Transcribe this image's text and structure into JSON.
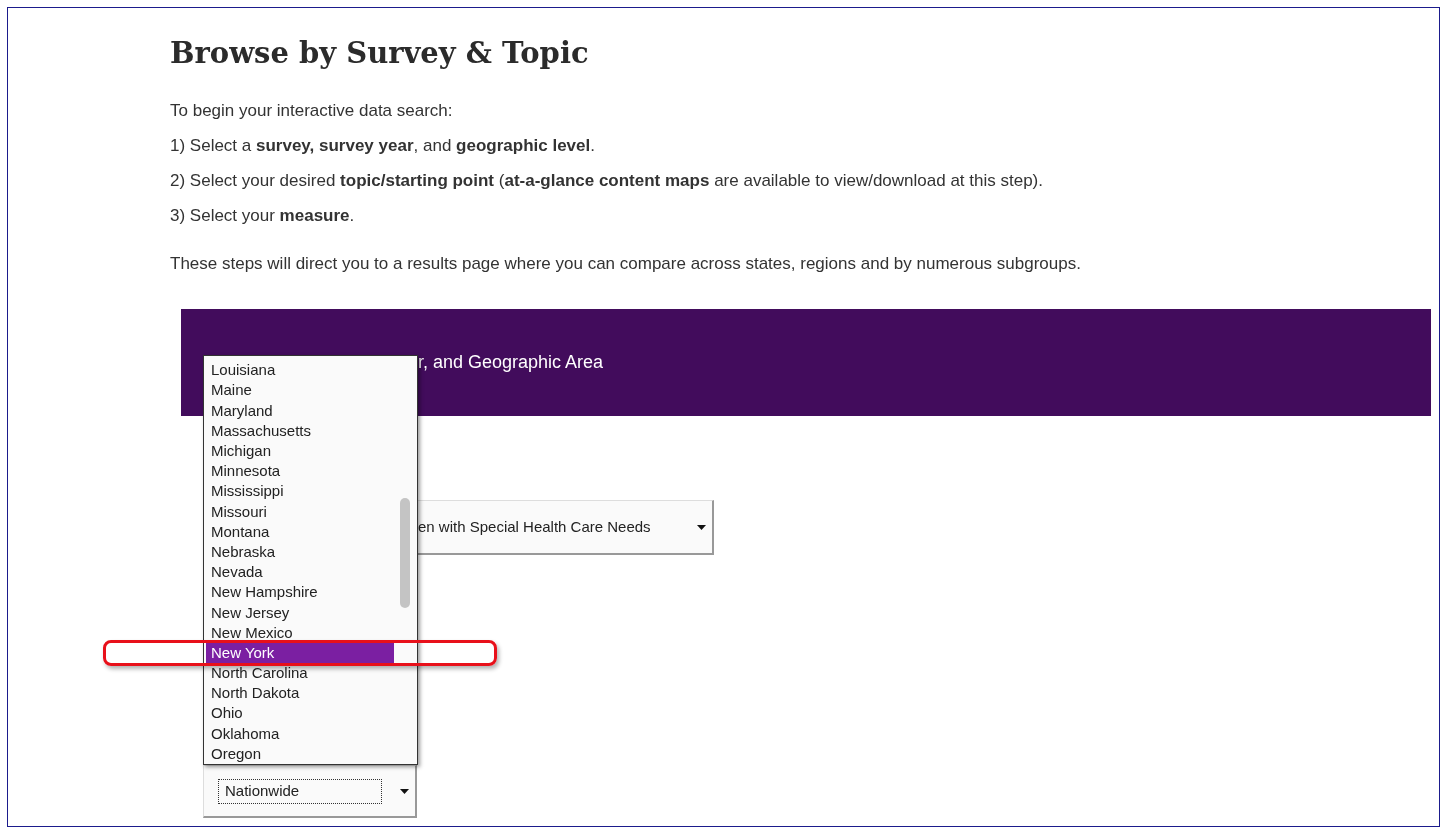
{
  "heading": "Browse by Survey & Topic",
  "intro": "To begin your interactive data search:",
  "steps": [
    "1) Select a **survey, survey year**, and **geographic level**.",
    "2) Select your desired **topic/starting point** (**at-a-glance content maps** are available to view/download at this step).",
    "3) Select your **measure**."
  ],
  "note": "These steps will direct you to a results page where you can compare across states, regions and by numerous subgroups.",
  "panel": {
    "title": "r, and Geographic Area"
  },
  "survey_select": {
    "value": "en with Special Health Care Needs"
  },
  "geography_select": {
    "value": "Nationwide"
  },
  "state_list": {
    "items": [
      {
        "label": "Louisiana",
        "selected": false
      },
      {
        "label": "Maine",
        "selected": false
      },
      {
        "label": "Maryland",
        "selected": false
      },
      {
        "label": "Massachusetts",
        "selected": false
      },
      {
        "label": "Michigan",
        "selected": false
      },
      {
        "label": "Minnesota",
        "selected": false
      },
      {
        "label": "Mississippi",
        "selected": false
      },
      {
        "label": "Missouri",
        "selected": false
      },
      {
        "label": "Montana",
        "selected": false
      },
      {
        "label": "Nebraska",
        "selected": false
      },
      {
        "label": "Nevada",
        "selected": false
      },
      {
        "label": "New Hampshire",
        "selected": false
      },
      {
        "label": "New Jersey",
        "selected": false
      },
      {
        "label": "New Mexico",
        "selected": false
      },
      {
        "label": "New York",
        "selected": true
      },
      {
        "label": "North Carolina",
        "selected": false
      },
      {
        "label": "North Dakota",
        "selected": false
      },
      {
        "label": "Ohio",
        "selected": false
      },
      {
        "label": "Oklahoma",
        "selected": false
      },
      {
        "label": "Oregon",
        "selected": false
      }
    ]
  }
}
